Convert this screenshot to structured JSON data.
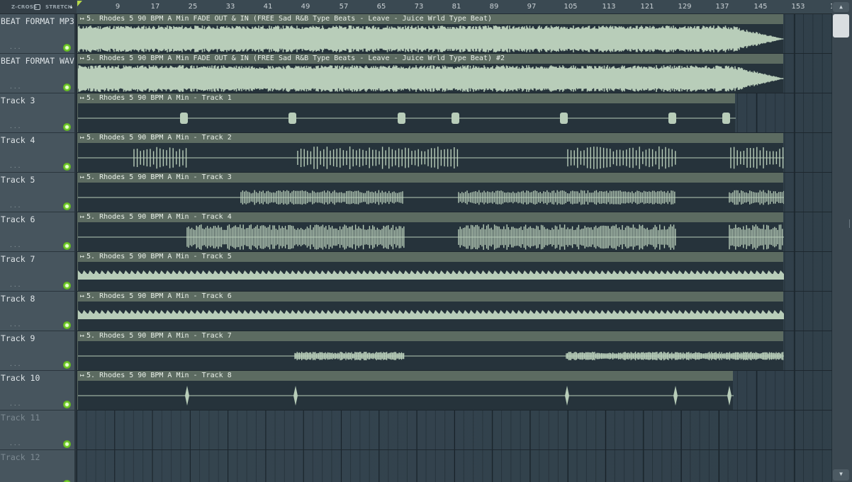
{
  "toolbar": {
    "zcross_label": "Z-CROSS",
    "stretch_label": "STRETCH"
  },
  "ruler": {
    "ticks": [
      "9",
      "17",
      "25",
      "33",
      "41",
      "49",
      "57",
      "65",
      "73",
      "81",
      "89",
      "97",
      "105",
      "113",
      "121",
      "129",
      "137",
      "145",
      "153"
    ],
    "last_partial": "1"
  },
  "tracks": [
    {
      "name": "BEAT FORMAT MP3",
      "clip": "5. Rhodes 5 90 BPM A Min FADE OUT & IN (FREE Sad R&B Type Beats - Leave - Juice Wrld Type Beat)"
    },
    {
      "name": "BEAT FORMAT WAV",
      "clip": "5. Rhodes 5 90 BPM A Min FADE OUT & IN (FREE Sad R&B Type Beats - Leave - Juice Wrld Type Beat) #2"
    },
    {
      "name": "Track 3",
      "clip": "5. Rhodes 5 90 BPM A Min - Track 1"
    },
    {
      "name": "Track 4",
      "clip": "5. Rhodes 5 90 BPM A Min - Track 2"
    },
    {
      "name": "Track 5",
      "clip": "5. Rhodes 5 90 BPM A Min - Track 3"
    },
    {
      "name": "Track 6",
      "clip": "5. Rhodes 5 90 BPM A Min - Track 4"
    },
    {
      "name": "Track 7",
      "clip": "5. Rhodes 5 90 BPM A Min - Track 5"
    },
    {
      "name": "Track 8",
      "clip": "5. Rhodes 5 90 BPM A Min - Track 6"
    },
    {
      "name": "Track 9",
      "clip": "5. Rhodes 5 90 BPM A Min - Track 7"
    },
    {
      "name": "Track 10",
      "clip": "5. Rhodes 5 90 BPM A Min - Track 8"
    },
    {
      "name": "Track 11"
    },
    {
      "name": "Track 12"
    }
  ],
  "colors": {
    "waveform": "#b8cdb9",
    "clip_header": "#5c6b61",
    "led": "#79d12e",
    "playhead": "#b8d94a"
  },
  "icons": {
    "playhead": "playhead-marker-icon",
    "clip_arrow": "clip-menu-arrow-icon",
    "mute_led": "track-enable-led-icon"
  }
}
